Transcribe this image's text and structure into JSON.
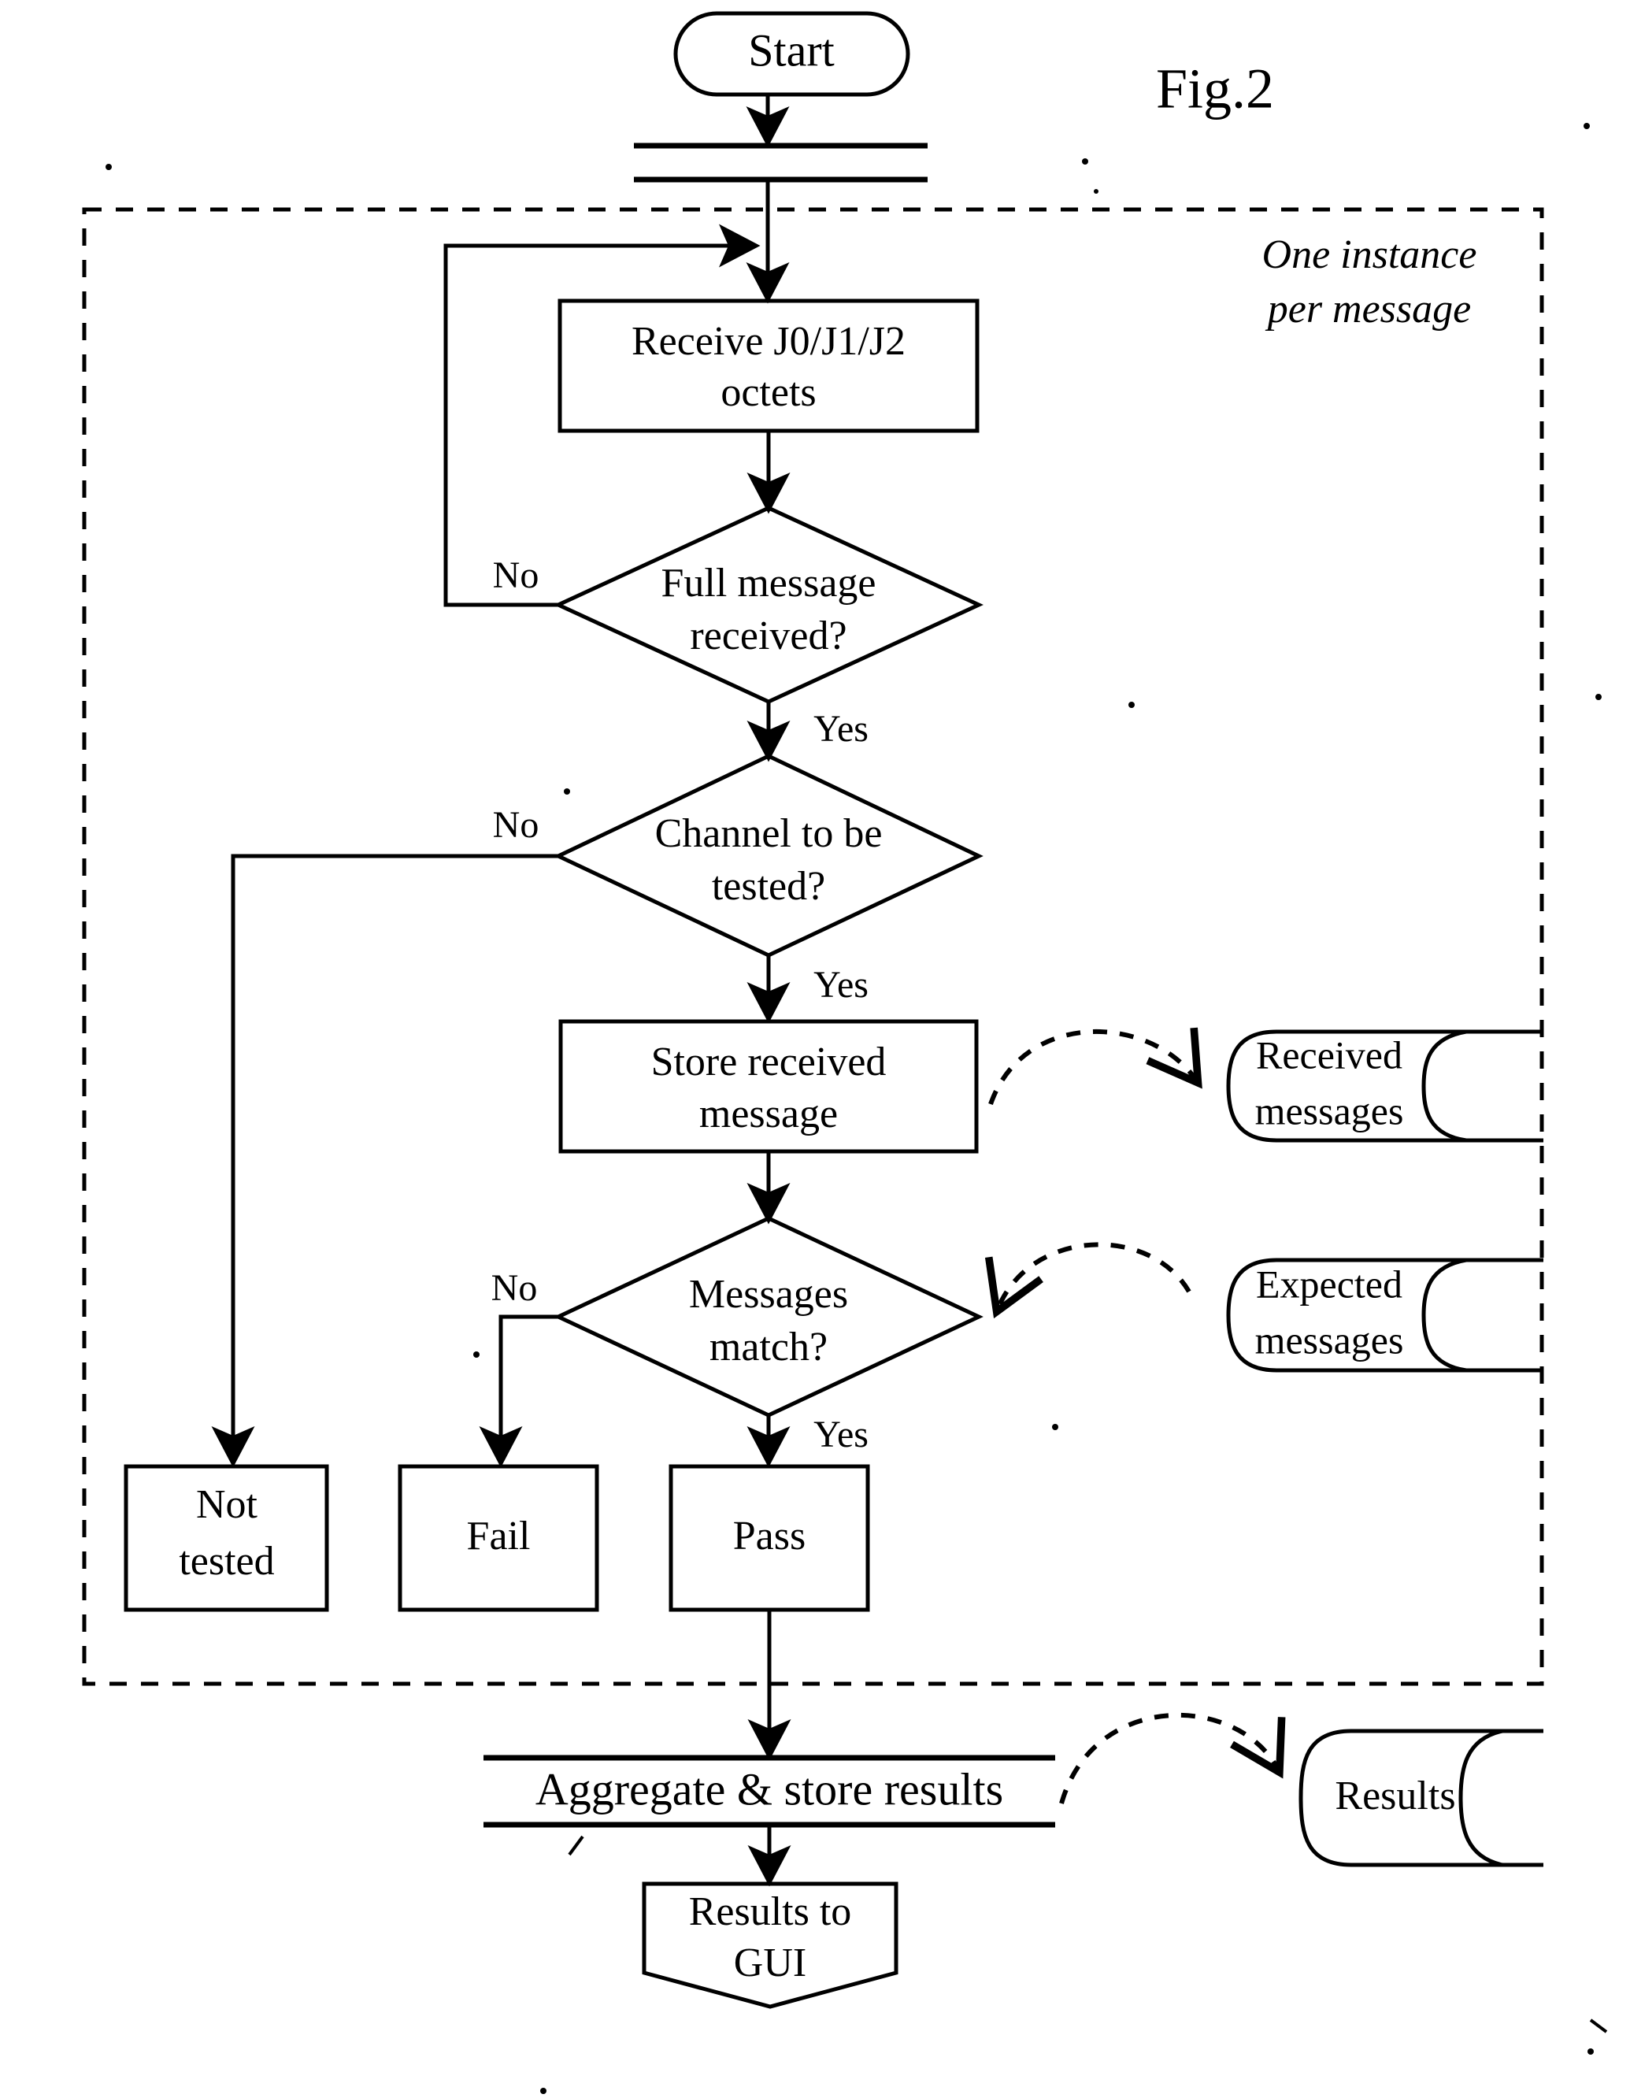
{
  "figure": {
    "label": "Fig.2",
    "region_note_line1": "One instance",
    "region_note_line2": "per message"
  },
  "nodes": {
    "start": {
      "label": "Start",
      "shape": "terminator"
    },
    "receive": {
      "label_line1": "Receive J0/J1/J2",
      "label_line2": "octets",
      "shape": "process"
    },
    "full_message": {
      "label_line1": "Full message",
      "label_line2": "received?",
      "shape": "decision"
    },
    "channel_tested": {
      "label_line1": "Channel to be",
      "label_line2": "tested?",
      "shape": "decision"
    },
    "store_message": {
      "label_line1": "Store received",
      "label_line2": "message",
      "shape": "process"
    },
    "messages_match": {
      "label_line1": "Messages",
      "label_line2": "match?",
      "shape": "decision"
    },
    "not_tested": {
      "label_line1": "Not",
      "label_line2": "tested",
      "shape": "process"
    },
    "fail": {
      "label": "Fail",
      "shape": "process"
    },
    "pass": {
      "label": "Pass",
      "shape": "process"
    },
    "aggregate": {
      "label": "Aggregate & store results",
      "shape": "band"
    },
    "results_to_gui": {
      "label_line1": "Results to",
      "label_line2": "GUI",
      "shape": "display"
    }
  },
  "datastores": {
    "received_messages": {
      "label_line1": "Received",
      "label_line2": "messages"
    },
    "expected_messages": {
      "label_line1": "Expected",
      "label_line2": "messages"
    },
    "results": {
      "label": "Results"
    }
  },
  "edge_labels": {
    "full_message_no": "No",
    "full_message_yes": "Yes",
    "channel_no": "No",
    "channel_yes": "Yes",
    "match_no": "No",
    "match_yes": "Yes"
  },
  "colors": {
    "ink": "#000000",
    "paper": "#ffffff"
  }
}
